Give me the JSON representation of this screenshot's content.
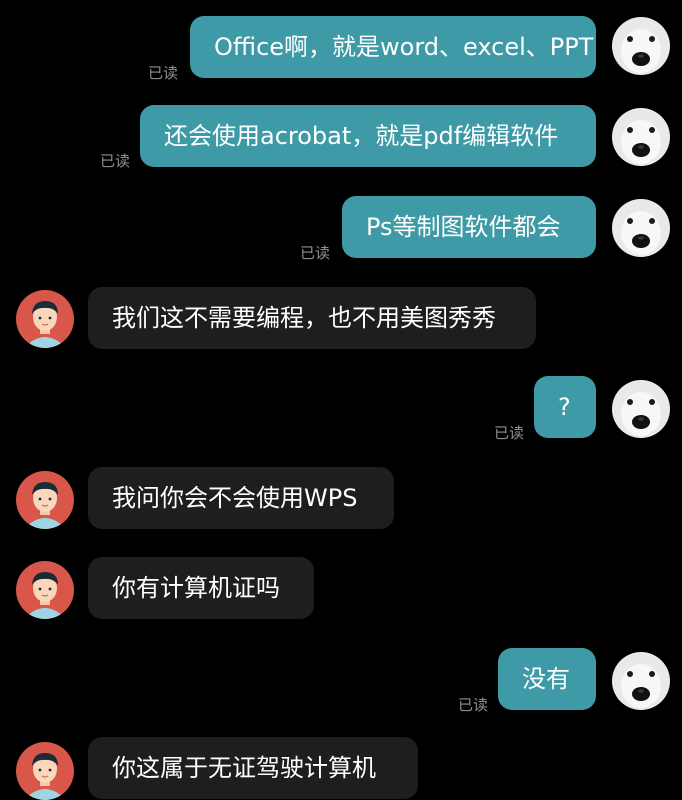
{
  "read_label": "已读",
  "messages": [
    {
      "side": "right",
      "text": "Office啊，就是word、excel、PPT",
      "read": "已读"
    },
    {
      "side": "right",
      "text": "还会使用acrobat，就是pdf编辑软件",
      "read": "已读"
    },
    {
      "side": "right",
      "text": "Ps等制图软件都会",
      "read": "已读"
    },
    {
      "side": "left",
      "text": "我们这不需要编程，也不用美图秀秀"
    },
    {
      "side": "right",
      "text": "?",
      "read": "已读"
    },
    {
      "side": "left",
      "text": "我问你会不会使用WPS"
    },
    {
      "side": "left",
      "text": "你有计算机证吗"
    },
    {
      "side": "right",
      "text": "没有",
      "read": "已读"
    },
    {
      "side": "left",
      "text": "你这属于无证驾驶计算机"
    }
  ],
  "colors": {
    "background": "#000000",
    "outgoing_bubble": "#3e9aa6",
    "incoming_bubble": "#1e1e20",
    "read_text": "#8f8f8f"
  },
  "icons": {
    "self_avatar": "dog-avatar-icon",
    "other_avatar": "cartoon-man-avatar-icon"
  }
}
